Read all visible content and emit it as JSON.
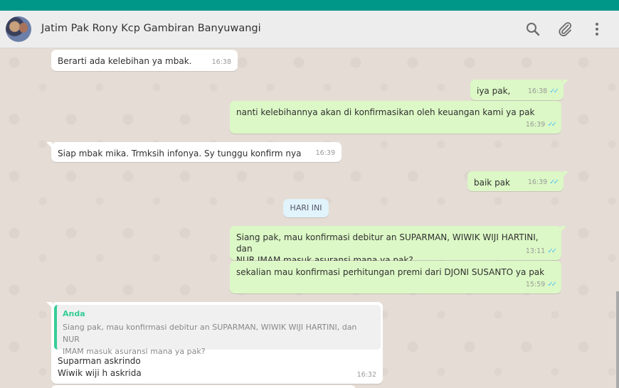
{
  "header": {
    "title": "Jatim Pak Rony Kcp Gambiran Banyuwangi",
    "icons": [
      "search-icon",
      "attach-icon",
      "menu-icon"
    ]
  },
  "colors": {
    "topbar": "#009688",
    "incoming": "#ffffff",
    "outgoing": "#dcf8c6",
    "ticks": "#4fc3f7"
  },
  "messages": [
    {
      "dir": "in",
      "text": "Berarti ada kelebihan ya mbak.",
      "time": "16:38"
    },
    {
      "dir": "out",
      "text": "iya pak,",
      "time": "16:38",
      "read": true
    },
    {
      "dir": "out",
      "text": "nanti kelebihannya akan di konfirmasikan oleh keuangan kami ya pak",
      "time": "16:39",
      "read": true
    },
    {
      "dir": "in",
      "text": "Siap mbak mika. Trmksih infonya. Sy tunggu konfirm nya",
      "time": "16:39"
    },
    {
      "dir": "out",
      "text": "baik pak",
      "time": "16:39",
      "read": true
    },
    {
      "dir": "out",
      "line1": "Siang pak, mau konfirmasi debitur an SUPARMAN, WIWIK WIJI HARTINI, dan",
      "line2": "NUR IMAM masuk asuransi mana ya pak?",
      "time": "13:11",
      "read": true
    },
    {
      "dir": "out",
      "text": "sekalian mau konfirmasi perhitungan premi dari DJONI SUSANTO ya pak",
      "time": "15:59",
      "read": true
    }
  ],
  "day_separator": "HARI INI",
  "reply": {
    "quote_author": "Anda",
    "quote_line1": "Siang pak, mau konfirmasi debitur an SUPARMAN, WIWIK WIJI HARTINI, dan NUR",
    "quote_line2": "IMAM masuk asuransi mana ya pak?",
    "line1": "Suparman askrindo",
    "line2": "Wiwik wiji h askrida",
    "time": "16:32"
  }
}
